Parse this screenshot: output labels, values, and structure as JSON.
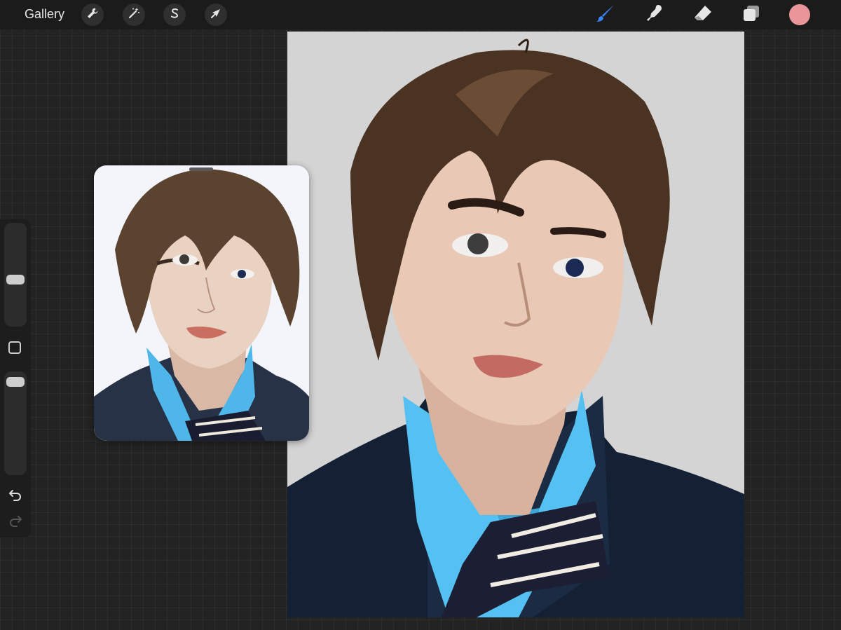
{
  "toolbar": {
    "gallery_label": "Gallery",
    "left_tools": [
      {
        "name": "actions",
        "icon": "wrench-icon"
      },
      {
        "name": "adjustments",
        "icon": "magic-wand-icon"
      },
      {
        "name": "selection",
        "icon": "selection-s-icon"
      },
      {
        "name": "transform",
        "icon": "arrow-cursor-icon"
      }
    ],
    "right_tools": [
      {
        "name": "paint",
        "icon": "brush-icon",
        "active": true,
        "color": "#3a86ff"
      },
      {
        "name": "smudge",
        "icon": "smudge-finger-icon"
      },
      {
        "name": "erase",
        "icon": "eraser-icon"
      },
      {
        "name": "layers",
        "icon": "layers-icon"
      }
    ],
    "current_color": "#e9959a"
  },
  "sidebar": {
    "brush_size_level": 0.45,
    "opacity_level": 0.94,
    "icons": [
      "modify-square-icon",
      "undo-icon",
      "redo-icon"
    ]
  },
  "reference_window": {
    "content": "reference-photo",
    "colors": {
      "background": "#f3f5fb",
      "shirt": "#4fb6ea",
      "jacket": "#283247",
      "hair": "#5b4330"
    }
  },
  "canvas": {
    "content": "digital-portrait-painting",
    "colors": {
      "background": "#d4d4d4",
      "shirt": "#55c1f2",
      "jacket": "#142033",
      "hair": "#4a3322",
      "skin": "#e9c9b6",
      "lips": "#c36b62"
    }
  }
}
